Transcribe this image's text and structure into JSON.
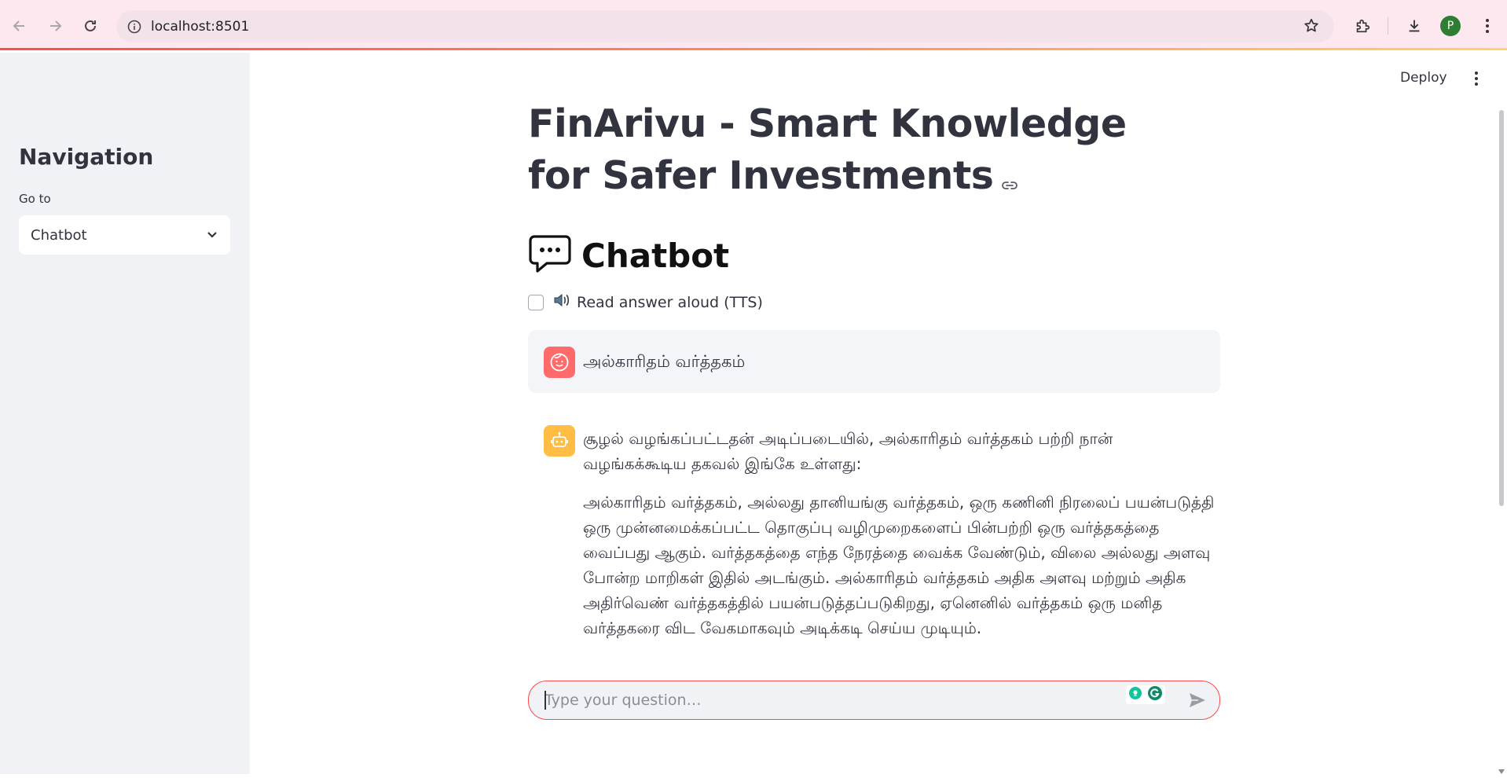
{
  "browser": {
    "url": "localhost:8501",
    "profile_initial": "P"
  },
  "app": {
    "deploy_label": "Deploy",
    "title": "FinArivu - Smart Knowledge for Safer Investments"
  },
  "sidebar": {
    "heading": "Navigation",
    "select_label": "Go to",
    "select_value": "Chatbot"
  },
  "chat": {
    "heading": "Chatbot",
    "tts_label": "Read answer aloud (TTS)",
    "messages": [
      {
        "role": "user",
        "text": "அல்காரிதம் வர்த்தகம்"
      },
      {
        "role": "assistant",
        "intro": "சூழல் வழங்கப்பட்டதன் அடிப்படையில், அல்காரிதம் வர்த்தகம் பற்றி நான் வழங்கக்கூடிய தகவல் இங்கே உள்ளது:",
        "body": "அல்காரிதம் வர்த்தகம், அல்லது தானியங்கு வர்த்தகம், ஒரு கணினி நிரலைப் பயன்படுத்தி ஒரு முன்னமைக்கப்பட்ட தொகுப்பு வழிமுறைகளைப் பின்பற்றி ஒரு வர்த்தகத்தை வைப்பது ஆகும். வர்த்தகத்தை எந்த நேரத்தை வைக்க வேண்டும், விலை அல்லது அளவு போன்ற மாறிகள் இதில் அடங்கும். அல்காரிதம் வர்த்தகம் அதிக அளவு மற்றும் அதிக அதிர்வெண் வர்த்தகத்தில் பயன்படுத்தப்படுகிறது, ஏனெனில் வர்த்தகம் ஒரு மனித வர்த்தகரை விட வேகமாகவும் அடிக்கடி செய்ய முடியும்."
      }
    ],
    "input_placeholder": "Type your question…",
    "input_value": ""
  },
  "colors": {
    "accent": "#ff4b4b",
    "sidebar_bg": "#f0f2f6",
    "text": "#31333f",
    "user_avatar": "#ff6b6b",
    "bot_avatar": "#ffbd45",
    "chrome_bg": "#fce8ee"
  },
  "icons": {
    "back": "arrow-left-icon",
    "forward": "arrow-right-icon",
    "reload": "reload-icon",
    "site_info": "info-icon",
    "bookmark": "star-icon",
    "extensions": "puzzle-icon",
    "download": "download-icon",
    "chrome_menu": "kebab-icon",
    "app_menu": "kebab-icon",
    "select": "chevron-down-icon",
    "title_anchor": "link-icon",
    "chat_heading": "speech-bubble-icon",
    "tts": "speaker-icon",
    "user_avatar": "smiley-face-icon",
    "bot_avatar": "robot-icon",
    "send": "send-icon"
  }
}
